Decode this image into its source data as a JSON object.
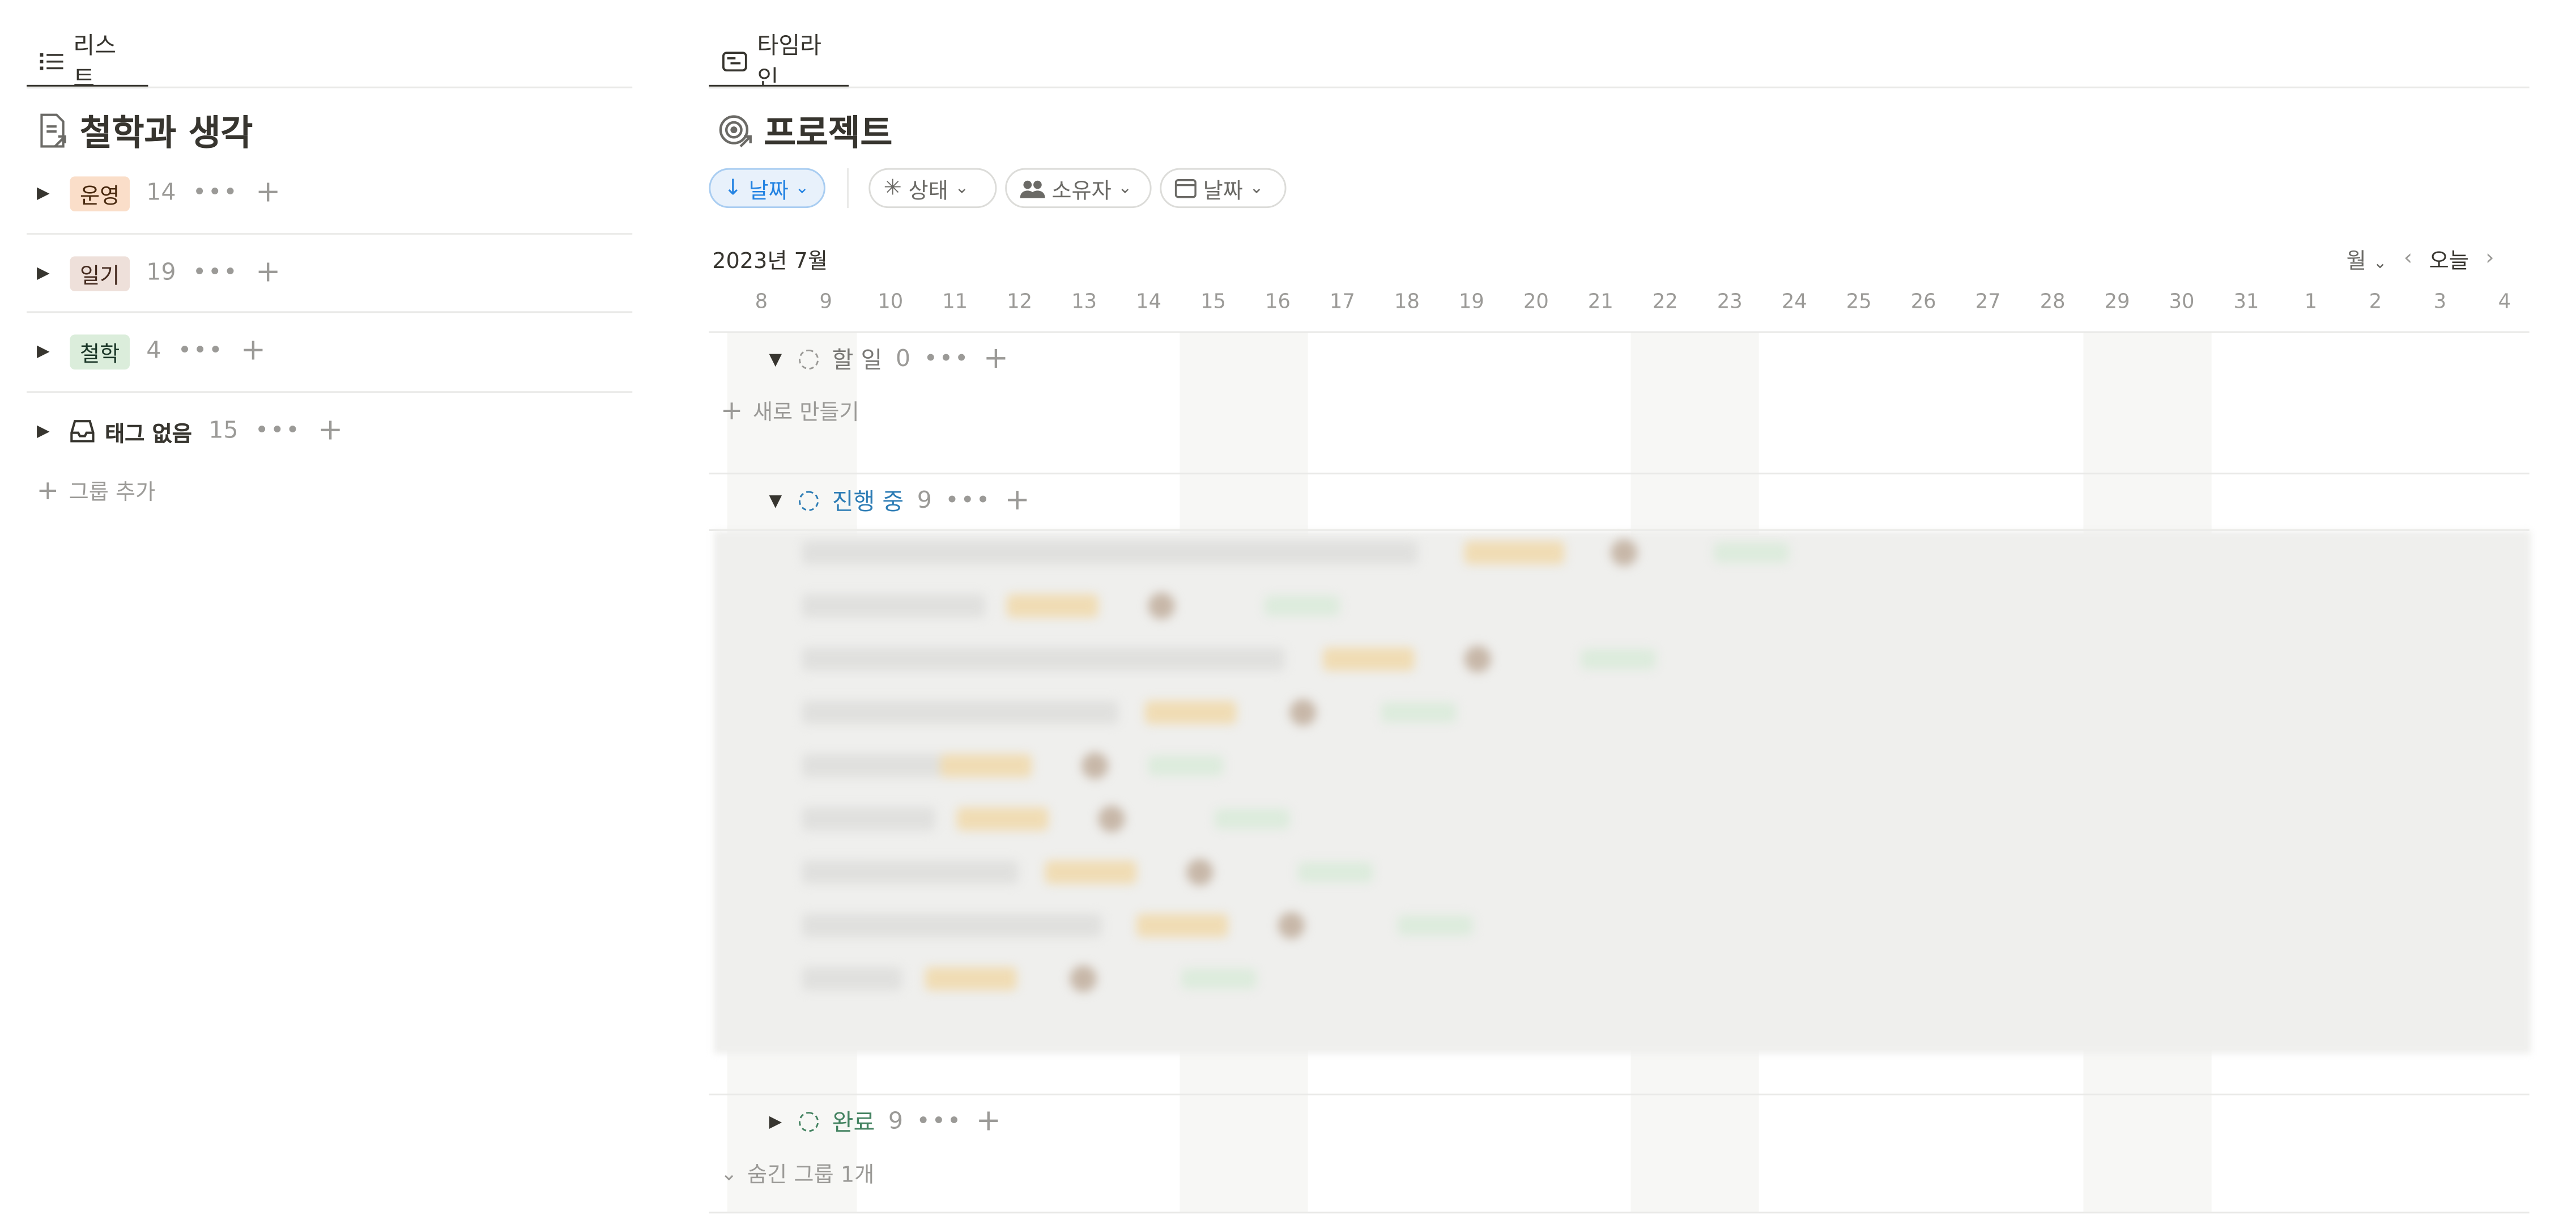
{
  "left_panel": {
    "tab_label": "리스트",
    "title": "철학과 생각",
    "groups": [
      {
        "label": "운영",
        "count": "14",
        "tag_bg": "#fadec9",
        "tag_color": "#49290e"
      },
      {
        "label": "일기",
        "count": "19",
        "tag_bg": "#eee0da",
        "tag_color": "#442a1e"
      },
      {
        "label": "철학",
        "count": "4",
        "tag_bg": "#dbeddb",
        "tag_color": "#1c3829"
      },
      {
        "label": "태그 없음",
        "count": "15"
      }
    ],
    "add_group_label": "그룹 추가"
  },
  "timeline": {
    "tab_label": "타임라인",
    "title": "프로젝트",
    "filters": [
      {
        "label": "날짜",
        "icon": "arrow-down-icon",
        "active": true
      },
      {
        "label": "상태",
        "icon": "status-spinner-icon",
        "active": false
      },
      {
        "label": "소유자",
        "icon": "people-icon",
        "active": false
      },
      {
        "label": "날짜",
        "icon": "calendar-icon",
        "active": false
      }
    ],
    "month_label": "2023년 7월",
    "zoom_label": "월",
    "today_label": "오늘",
    "days": [
      "8",
      "9",
      "10",
      "11",
      "12",
      "13",
      "14",
      "15",
      "16",
      "17",
      "18",
      "19",
      "20",
      "21",
      "22",
      "23",
      "24",
      "25",
      "26",
      "27",
      "28",
      "29",
      "30",
      "31",
      "1",
      "2",
      "3",
      "4"
    ],
    "groups": [
      {
        "label": "할 일",
        "count": "0",
        "new_label": "새로 만들기",
        "color": "#787774"
      },
      {
        "label": "진행 중",
        "count": "9",
        "color": "#2e7db5"
      },
      {
        "label": "완료",
        "count": "9",
        "color": "#448361"
      }
    ],
    "hidden_groups_label": "숨긴 그룹 1개"
  }
}
